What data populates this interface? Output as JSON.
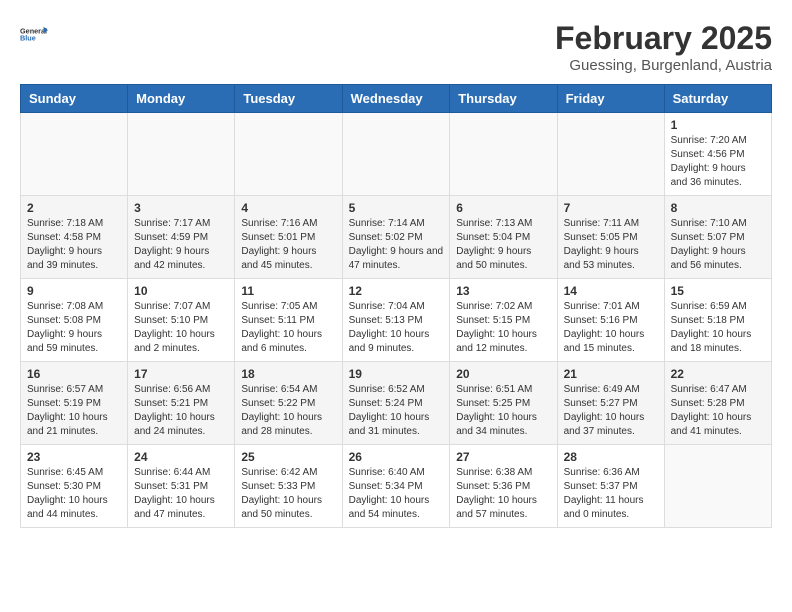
{
  "header": {
    "logo_general": "General",
    "logo_blue": "Blue",
    "title": "February 2025",
    "location": "Guessing, Burgenland, Austria"
  },
  "weekdays": [
    "Sunday",
    "Monday",
    "Tuesday",
    "Wednesday",
    "Thursday",
    "Friday",
    "Saturday"
  ],
  "weeks": [
    [
      {
        "day": "",
        "info": ""
      },
      {
        "day": "",
        "info": ""
      },
      {
        "day": "",
        "info": ""
      },
      {
        "day": "",
        "info": ""
      },
      {
        "day": "",
        "info": ""
      },
      {
        "day": "",
        "info": ""
      },
      {
        "day": "1",
        "info": "Sunrise: 7:20 AM\nSunset: 4:56 PM\nDaylight: 9 hours and 36 minutes."
      }
    ],
    [
      {
        "day": "2",
        "info": "Sunrise: 7:18 AM\nSunset: 4:58 PM\nDaylight: 9 hours and 39 minutes."
      },
      {
        "day": "3",
        "info": "Sunrise: 7:17 AM\nSunset: 4:59 PM\nDaylight: 9 hours and 42 minutes."
      },
      {
        "day": "4",
        "info": "Sunrise: 7:16 AM\nSunset: 5:01 PM\nDaylight: 9 hours and 45 minutes."
      },
      {
        "day": "5",
        "info": "Sunrise: 7:14 AM\nSunset: 5:02 PM\nDaylight: 9 hours and 47 minutes."
      },
      {
        "day": "6",
        "info": "Sunrise: 7:13 AM\nSunset: 5:04 PM\nDaylight: 9 hours and 50 minutes."
      },
      {
        "day": "7",
        "info": "Sunrise: 7:11 AM\nSunset: 5:05 PM\nDaylight: 9 hours and 53 minutes."
      },
      {
        "day": "8",
        "info": "Sunrise: 7:10 AM\nSunset: 5:07 PM\nDaylight: 9 hours and 56 minutes."
      }
    ],
    [
      {
        "day": "9",
        "info": "Sunrise: 7:08 AM\nSunset: 5:08 PM\nDaylight: 9 hours and 59 minutes."
      },
      {
        "day": "10",
        "info": "Sunrise: 7:07 AM\nSunset: 5:10 PM\nDaylight: 10 hours and 2 minutes."
      },
      {
        "day": "11",
        "info": "Sunrise: 7:05 AM\nSunset: 5:11 PM\nDaylight: 10 hours and 6 minutes."
      },
      {
        "day": "12",
        "info": "Sunrise: 7:04 AM\nSunset: 5:13 PM\nDaylight: 10 hours and 9 minutes."
      },
      {
        "day": "13",
        "info": "Sunrise: 7:02 AM\nSunset: 5:15 PM\nDaylight: 10 hours and 12 minutes."
      },
      {
        "day": "14",
        "info": "Sunrise: 7:01 AM\nSunset: 5:16 PM\nDaylight: 10 hours and 15 minutes."
      },
      {
        "day": "15",
        "info": "Sunrise: 6:59 AM\nSunset: 5:18 PM\nDaylight: 10 hours and 18 minutes."
      }
    ],
    [
      {
        "day": "16",
        "info": "Sunrise: 6:57 AM\nSunset: 5:19 PM\nDaylight: 10 hours and 21 minutes."
      },
      {
        "day": "17",
        "info": "Sunrise: 6:56 AM\nSunset: 5:21 PM\nDaylight: 10 hours and 24 minutes."
      },
      {
        "day": "18",
        "info": "Sunrise: 6:54 AM\nSunset: 5:22 PM\nDaylight: 10 hours and 28 minutes."
      },
      {
        "day": "19",
        "info": "Sunrise: 6:52 AM\nSunset: 5:24 PM\nDaylight: 10 hours and 31 minutes."
      },
      {
        "day": "20",
        "info": "Sunrise: 6:51 AM\nSunset: 5:25 PM\nDaylight: 10 hours and 34 minutes."
      },
      {
        "day": "21",
        "info": "Sunrise: 6:49 AM\nSunset: 5:27 PM\nDaylight: 10 hours and 37 minutes."
      },
      {
        "day": "22",
        "info": "Sunrise: 6:47 AM\nSunset: 5:28 PM\nDaylight: 10 hours and 41 minutes."
      }
    ],
    [
      {
        "day": "23",
        "info": "Sunrise: 6:45 AM\nSunset: 5:30 PM\nDaylight: 10 hours and 44 minutes."
      },
      {
        "day": "24",
        "info": "Sunrise: 6:44 AM\nSunset: 5:31 PM\nDaylight: 10 hours and 47 minutes."
      },
      {
        "day": "25",
        "info": "Sunrise: 6:42 AM\nSunset: 5:33 PM\nDaylight: 10 hours and 50 minutes."
      },
      {
        "day": "26",
        "info": "Sunrise: 6:40 AM\nSunset: 5:34 PM\nDaylight: 10 hours and 54 minutes."
      },
      {
        "day": "27",
        "info": "Sunrise: 6:38 AM\nSunset: 5:36 PM\nDaylight: 10 hours and 57 minutes."
      },
      {
        "day": "28",
        "info": "Sunrise: 6:36 AM\nSunset: 5:37 PM\nDaylight: 11 hours and 0 minutes."
      },
      {
        "day": "",
        "info": ""
      }
    ]
  ]
}
